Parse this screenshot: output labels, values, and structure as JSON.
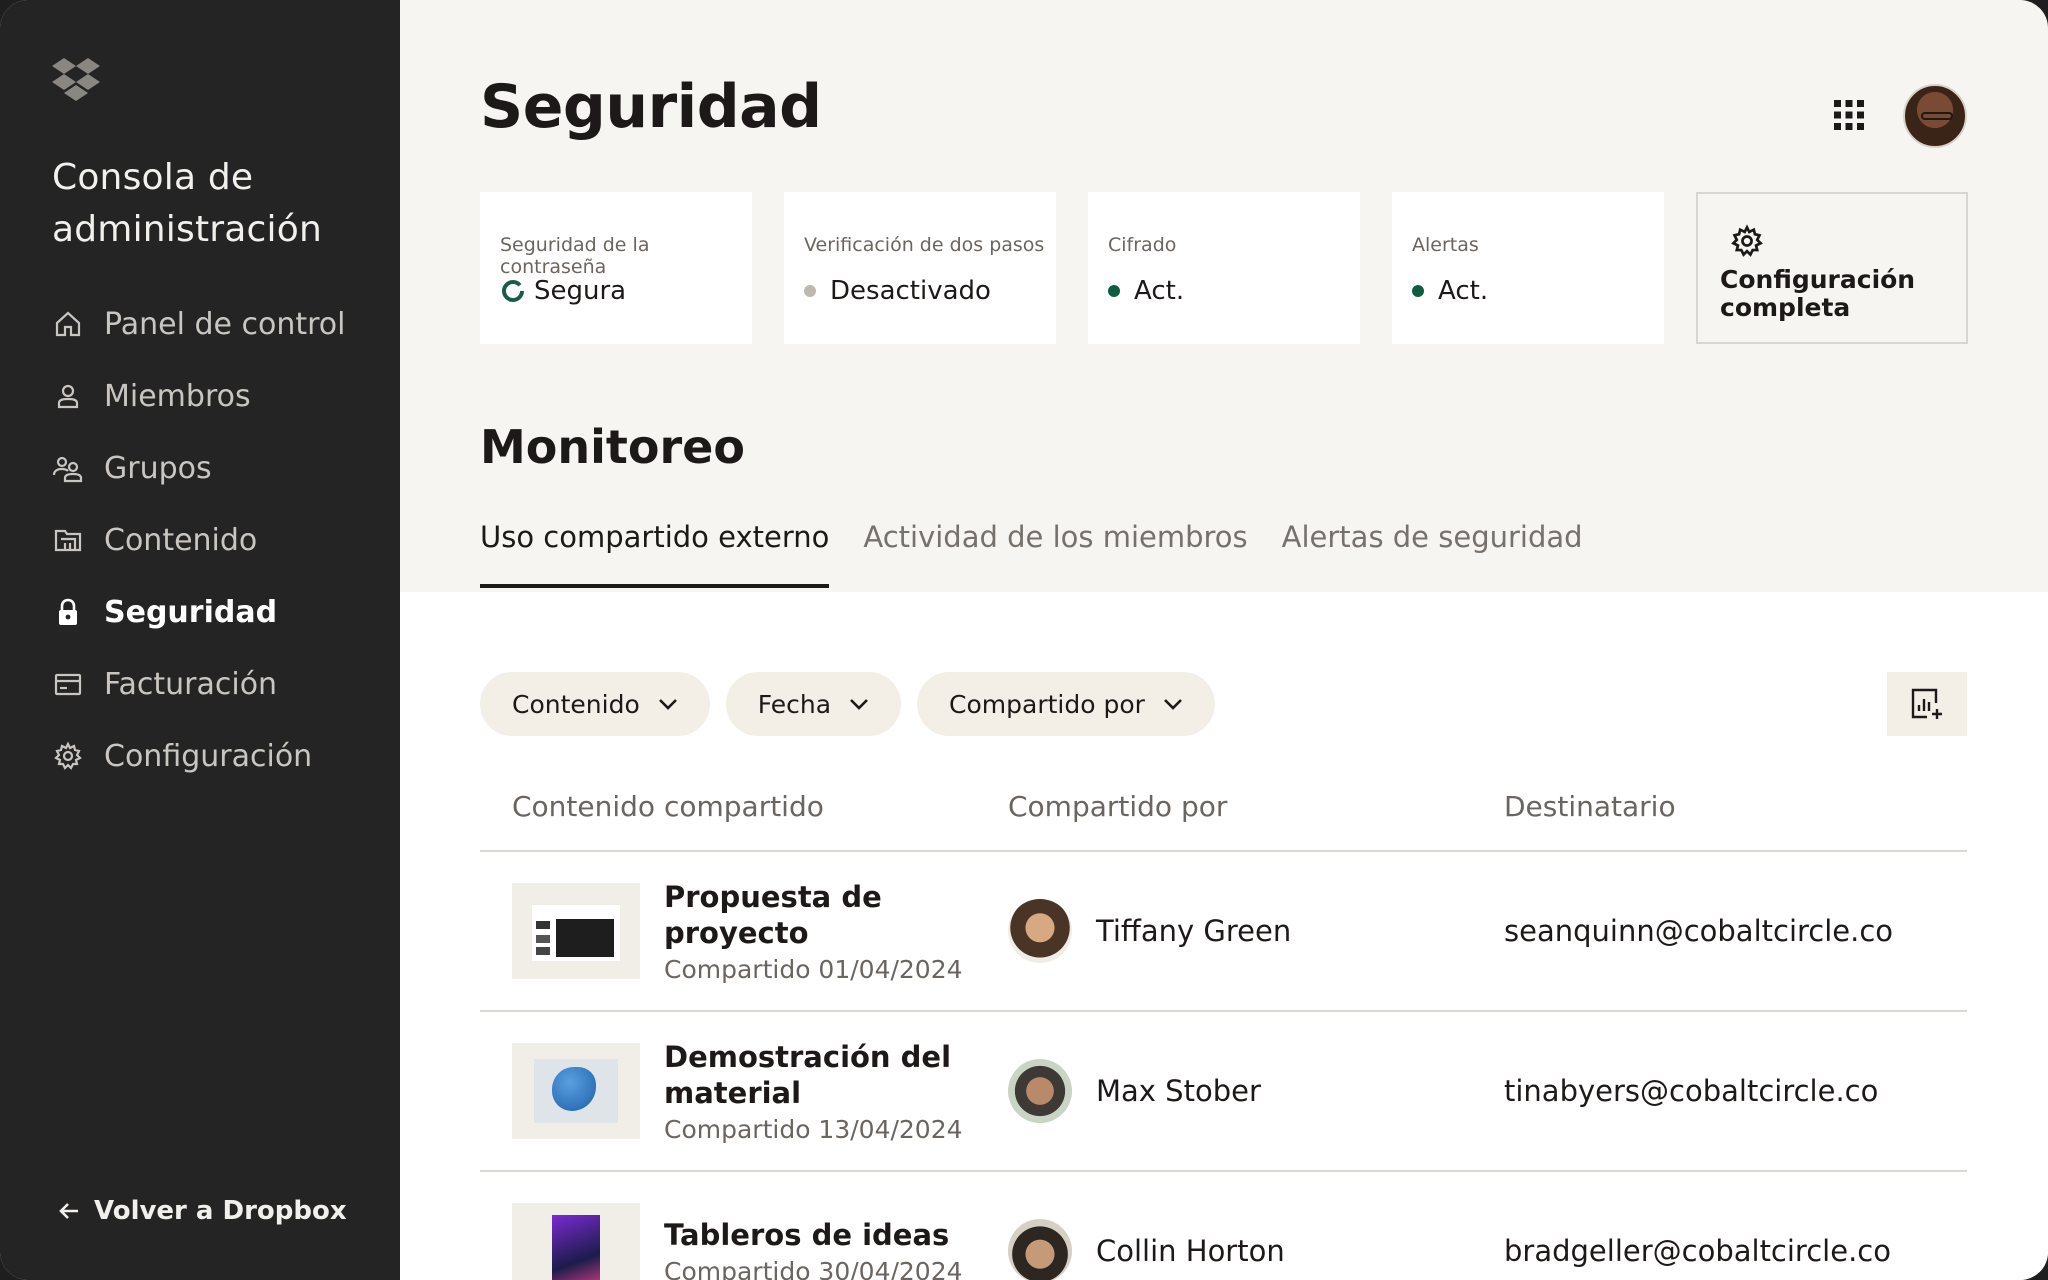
{
  "sidebar": {
    "title": "Consola de administración",
    "items": [
      {
        "label": "Panel de control",
        "icon": "home-icon"
      },
      {
        "label": "Miembros",
        "icon": "person-icon"
      },
      {
        "label": "Grupos",
        "icon": "group-icon"
      },
      {
        "label": "Contenido",
        "icon": "folder-icon"
      },
      {
        "label": "Seguridad",
        "icon": "lock-icon",
        "active": true
      },
      {
        "label": "Facturación",
        "icon": "billing-icon"
      },
      {
        "label": "Configuración",
        "icon": "gear-icon"
      }
    ],
    "back_label": "Volver a Dropbox"
  },
  "header": {
    "title": "Seguridad"
  },
  "cards": [
    {
      "label": "Seguridad de la contraseña",
      "value": "Segura",
      "indicator": "ring",
      "color": "#1a5c4a"
    },
    {
      "label": "Verificación de dos pasos",
      "value": "Desactivado",
      "indicator": "dot",
      "color": "#bdb8b0"
    },
    {
      "label": "Cifrado",
      "value": "Act.",
      "indicator": "dot",
      "color": "#0f5c3f"
    },
    {
      "label": "Alertas",
      "value": "Act.",
      "indicator": "dot",
      "color": "#0f5c3f"
    }
  ],
  "config_card": {
    "label": "Configuración completa"
  },
  "monitoring": {
    "title": "Monitoreo",
    "tabs": [
      {
        "label": "Uso compartido externo",
        "active": true
      },
      {
        "label": "Actividad de los miembros"
      },
      {
        "label": "Alertas de seguridad"
      }
    ]
  },
  "filters": [
    {
      "label": "Contenido"
    },
    {
      "label": "Fecha"
    },
    {
      "label": "Compartido por"
    }
  ],
  "table": {
    "headers": [
      "Contenido compartido",
      "Compartido por",
      "Destinatario"
    ],
    "rows": [
      {
        "title": "Propuesta de proyecto",
        "date": "Compartido 01/04/2024",
        "shared_by": "Tiffany Green",
        "recipient": "seanquinn@cobaltcircle.co"
      },
      {
        "title": "Demostración del material",
        "date": "Compartido 13/04/2024",
        "shared_by": "Max Stober",
        "recipient": "tinabyers@cobaltcircle.co"
      },
      {
        "title": "Tableros de ideas",
        "date": "Compartido 30/04/2024",
        "shared_by": "Collin Horton",
        "recipient": "bradgeller@cobaltcircle.co"
      }
    ]
  },
  "colors": {
    "sidebar_bg": "#242424",
    "page_bg": "#f7f5f2",
    "chip_bg": "#f3efe6",
    "active_dot": "#0f5c3f"
  }
}
